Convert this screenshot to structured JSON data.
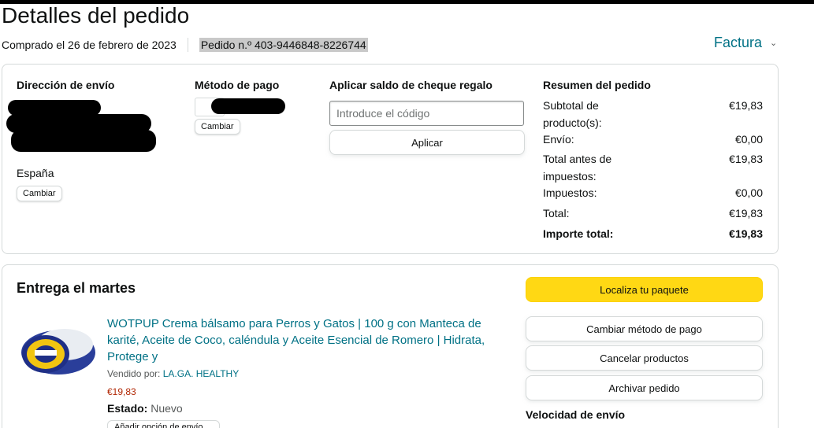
{
  "page": {
    "title": "Detalles del pedido",
    "purchased": "Comprado el 26 de febrero de 2023",
    "order_number": "Pedido n.º 403-9446848-8226744",
    "invoice_label": "Factura",
    "invoice_chevron": "⌄"
  },
  "shipping": {
    "heading": "Dirección de envío",
    "country": "España",
    "change_label": "Cambiar"
  },
  "payment": {
    "heading": "Método de pago",
    "change_label": "Cambiar"
  },
  "gift": {
    "heading": "Aplicar saldo de cheque regalo",
    "placeholder": "Introduce el código",
    "apply_label": "Aplicar"
  },
  "summary": {
    "heading": "Resumen del pedido",
    "rows": [
      {
        "label": "Subtotal de producto(s):",
        "value": "€19,83"
      },
      {
        "label": "Envío:",
        "value": "€0,00"
      },
      {
        "label": "Total antes de impuestos:",
        "value": "€19,83"
      },
      {
        "label": "Impuestos:",
        "value": "€0,00"
      },
      {
        "label": "Total:",
        "value": "€19,83"
      },
      {
        "label": "Importe total:",
        "value": "€19,83"
      }
    ]
  },
  "delivery": {
    "heading": "Entrega el martes",
    "product_title": "WOTPUP Crema bálsamo para Perros y Gatos | 100 g con Manteca de karité, Aceite de Coco, caléndula y Aceite Esencial de Romero | Hidrata, Protege y",
    "seller_label": "Vendido por:",
    "seller_name": "LA.GA. HEALTHY",
    "price": "€19,83",
    "status_label": "Estado:",
    "status_value": "Nuevo",
    "bottom_button": "Añadir opción de envío",
    "actions": {
      "track": "Localiza tu paquete",
      "change_payment": "Cambiar método de pago",
      "cancel": "Cancelar productos",
      "archive": "Archivar pedido"
    },
    "speed_heading": "Velocidad de envío"
  },
  "colors": {
    "link": "#007185",
    "yellow_button": "#ffd814",
    "price": "#b12704",
    "border": "#d5d9d9"
  }
}
